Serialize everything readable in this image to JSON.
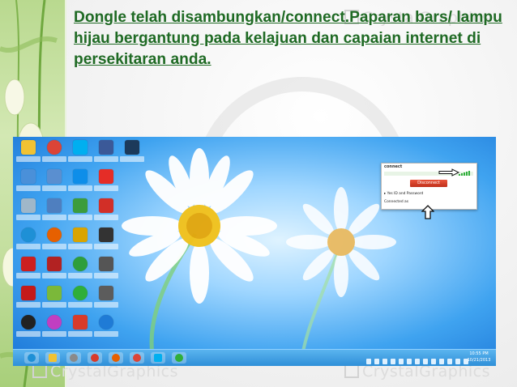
{
  "slide": {
    "title": "Dongle telah disambungkan/connect.Paparan bars/ lampu hijau bergantung pada kelajuan dan capaian internet di persekitaran anda.",
    "watermark_top": "CrystalGraphics",
    "watermark_bottom_left": "CrystalGraphics",
    "watermark_bottom_right": "CrystalGraphics",
    "title_color": "#1f6a24",
    "accent_green": "#a8cf7a"
  },
  "screenshot": {
    "desktop_icons": [
      {
        "icon": "folder-icon",
        "color": "#f1c232"
      },
      {
        "icon": "chrome-icon",
        "color": "#db4437"
      },
      {
        "icon": "skype-icon",
        "color": "#00aff0"
      },
      {
        "icon": "facebook-icon",
        "color": "#3b5998"
      },
      {
        "icon": "photoshop-icon",
        "color": "#1c3a5a"
      },
      {
        "icon": "computer-icon",
        "color": "#4a90d9"
      },
      {
        "icon": "network-icon",
        "color": "#5a8fd0"
      },
      {
        "icon": "teamviewer-icon",
        "color": "#0e8ee9"
      },
      {
        "icon": "youtube-icon",
        "color": "#e52d27"
      },
      {
        "icon": "recycle-bin-icon",
        "color": "#9fb7c9"
      },
      {
        "icon": "calendar-icon",
        "color": "#4f7fbf"
      },
      {
        "icon": "player-icon",
        "color": "#3c9c3c"
      },
      {
        "icon": "cutter-icon",
        "color": "#d22f27"
      },
      {
        "icon": "ie-icon",
        "color": "#1e90d6"
      },
      {
        "icon": "firefox-icon",
        "color": "#e66000"
      },
      {
        "icon": "winamp-icon",
        "color": "#d9a400"
      },
      {
        "icon": "drive-icon",
        "color": "#333333"
      },
      {
        "icon": "acrobat-icon",
        "color": "#cc1f1f"
      },
      {
        "icon": "pdf-tool-icon",
        "color": "#b22222"
      },
      {
        "icon": "connect-icon",
        "color": "#2e9e3c"
      },
      {
        "icon": "manager-icon",
        "color": "#555555"
      },
      {
        "icon": "antivirus-icon",
        "color": "#c41a1a"
      },
      {
        "icon": "freemake-icon",
        "color": "#7bb83a"
      },
      {
        "icon": "connect-green-icon",
        "color": "#2fae3a"
      },
      {
        "icon": "hp-icon",
        "color": "#5c5c5c"
      },
      {
        "icon": "cyberlink-icon",
        "color": "#222222"
      },
      {
        "icon": "picasa-icon",
        "color": "#c13fc1"
      },
      {
        "icon": "search-tool-icon",
        "color": "#d83b2a"
      },
      {
        "icon": "globe-icon",
        "color": "#1f7bd6"
      }
    ],
    "taskbar_items": [
      {
        "icon": "ie-taskbar-icon",
        "color": "#1e90d6"
      },
      {
        "icon": "explorer-taskbar-icon",
        "color": "#f1c232"
      },
      {
        "icon": "media-taskbar-icon",
        "color": "#8a8a8a"
      },
      {
        "icon": "tool-taskbar-icon",
        "color": "#d83b2a"
      },
      {
        "icon": "firefox-taskbar-icon",
        "color": "#e66000"
      },
      {
        "icon": "chrome-taskbar-icon",
        "color": "#db4437"
      },
      {
        "icon": "skype-taskbar-icon",
        "color": "#00aff0"
      },
      {
        "icon": "connect-taskbar-icon",
        "color": "#2fae3a"
      }
    ],
    "clock_time": "10:55 PM",
    "clock_date": "10/21/2013",
    "popup": {
      "title": "connect",
      "disconnect_label": "Disconnect",
      "line1": "▸ Yes ID and Password",
      "line2": "Connected as",
      "signal_color": "#2fae3a",
      "button_color": "#d23c22"
    }
  }
}
